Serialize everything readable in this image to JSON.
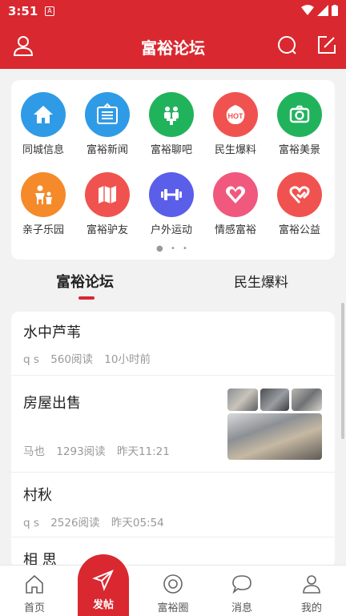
{
  "status_bar": {
    "time": "3:51",
    "app_badge": "A"
  },
  "header": {
    "title": "富裕论坛"
  },
  "categories": [
    {
      "label": "同城信息",
      "icon": "home-icon",
      "color": "#2f9be6"
    },
    {
      "label": "富裕新闻",
      "icon": "news-icon",
      "color": "#2f9be6"
    },
    {
      "label": "富裕聊吧",
      "icon": "chat-icon",
      "color": "#21b35c"
    },
    {
      "label": "民生爆料",
      "icon": "hot-icon",
      "color": "#f0534f"
    },
    {
      "label": "富裕美景",
      "icon": "camera-icon",
      "color": "#21b35c"
    },
    {
      "label": "亲子乐园",
      "icon": "family-icon",
      "color": "#f58a2a"
    },
    {
      "label": "富裕驴友",
      "icon": "map-icon",
      "color": "#f0534f"
    },
    {
      "label": "户外运动",
      "icon": "dumbbell-icon",
      "color": "#5a5ee8"
    },
    {
      "label": "情感富裕",
      "icon": "heart-icon",
      "color": "#f0587e"
    },
    {
      "label": "富裕公益",
      "icon": "charity-heart-icon",
      "color": "#f0534f"
    }
  ],
  "tabs": [
    {
      "label": "富裕论坛",
      "active": true
    },
    {
      "label": "民生爆料",
      "active": false
    }
  ],
  "posts": [
    {
      "title": "水中芦苇",
      "author": "q s",
      "reads": "560阅读",
      "time": "10小时前"
    },
    {
      "title": "房屋出售",
      "author": "马也",
      "reads": "1293阅读",
      "time": "昨天11:21"
    },
    {
      "title": "村秋",
      "author": "q s",
      "reads": "2526阅读",
      "time": "昨天05:54"
    },
    {
      "title": "相 思"
    }
  ],
  "bottom_nav": {
    "home": "首页",
    "post": "发帖",
    "circle": "富裕圈",
    "messages": "消息",
    "mine": "我的"
  },
  "colors": {
    "brand": "#d9282f"
  }
}
